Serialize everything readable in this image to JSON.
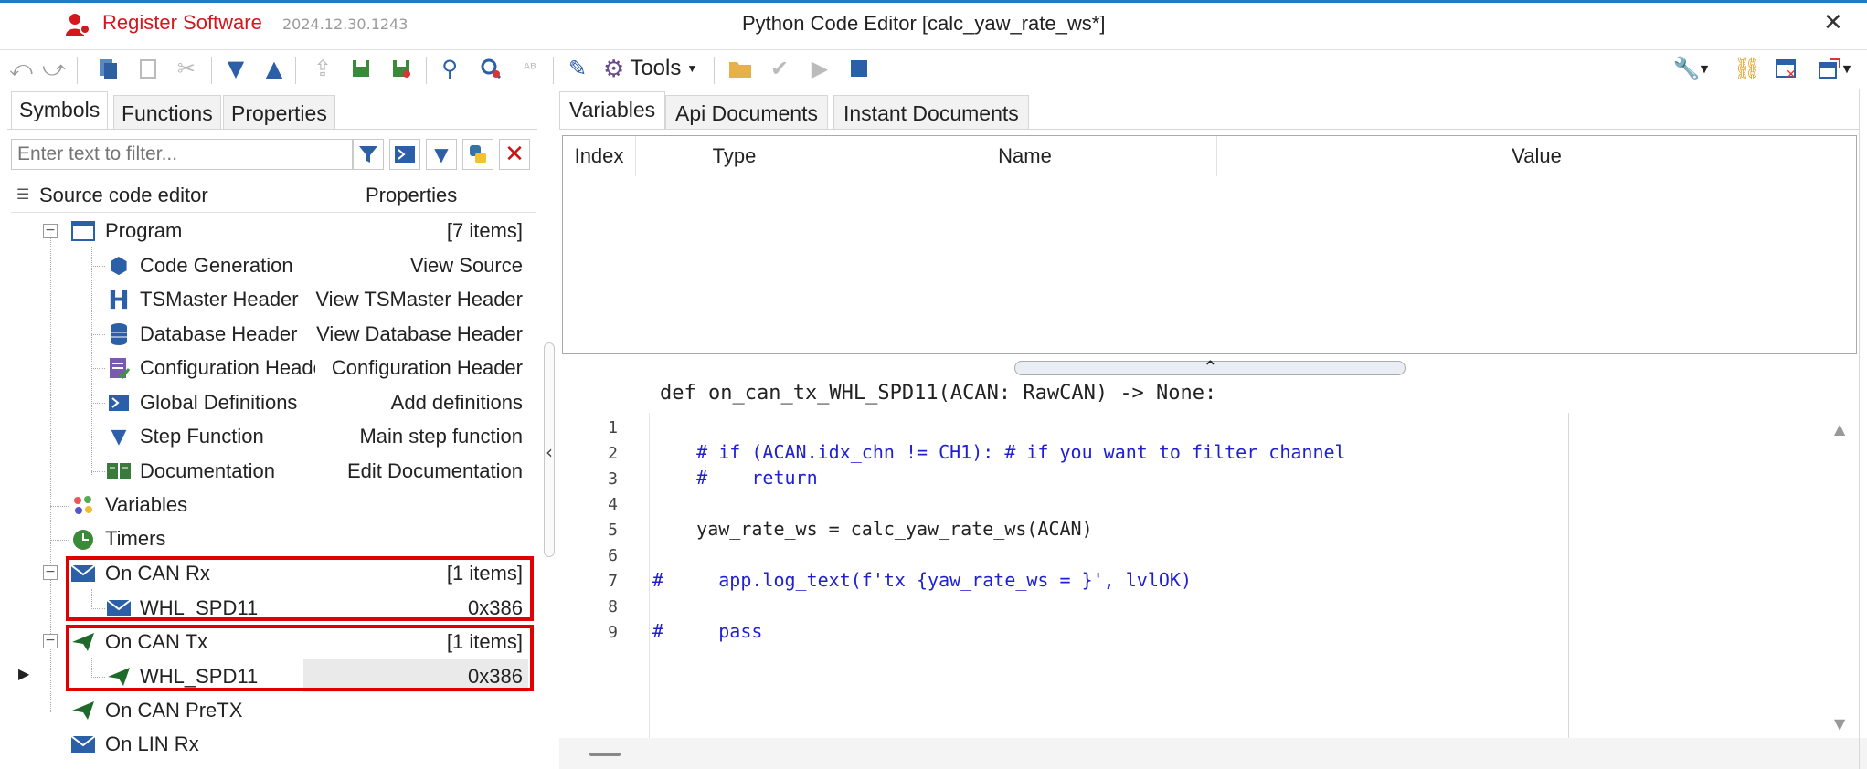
{
  "titlebar": {
    "register_label": "Register Software",
    "version": "2024.12.30.1243",
    "window_title": "Python Code Editor [calc_yaw_rate_ws*]",
    "close_glyph": "✕"
  },
  "toolbar": {
    "tools_label": "Tools",
    "icons": [
      "undo-icon",
      "redo-icon",
      "copy-icon",
      "paste-icon",
      "cut-icon",
      "move-down-icon",
      "move-up-icon",
      "export-icon",
      "save-icon",
      "save-as-icon",
      "search-icon",
      "find-replace-icon",
      "text-replace-icon",
      "pencil-icon",
      "gear-icon",
      "open-folder-icon",
      "check-icon",
      "run-icon",
      "stop-icon",
      "wrench-icon",
      "link-icon",
      "close-window-icon",
      "window-export-icon"
    ]
  },
  "left_tabs": [
    "Symbols",
    "Functions",
    "Properties"
  ],
  "filter": {
    "placeholder": "Enter text to filter..."
  },
  "tree_header": {
    "col1": "Source code editor",
    "col2": "Properties"
  },
  "tree": {
    "program": {
      "label": "Program",
      "value": "[7 items]"
    },
    "code_generation": {
      "label": "Code Generation",
      "value": "View Source"
    },
    "tsmaster_header": {
      "label": "TSMaster Header",
      "value": "View TSMaster Header"
    },
    "database_header": {
      "label": "Database Header",
      "value": "View Database Header"
    },
    "configuration_header": {
      "label": "Configuration Header",
      "value": "Configuration Header"
    },
    "global_definitions": {
      "label": "Global Definitions",
      "value": "Add definitions"
    },
    "step_function": {
      "label": "Step Function",
      "value": "Main step function"
    },
    "documentation": {
      "label": "Documentation",
      "value": "Edit Documentation"
    },
    "variables": {
      "label": "Variables"
    },
    "timers": {
      "label": "Timers"
    },
    "on_can_rx": {
      "label": "On CAN Rx",
      "value": "[1 items]"
    },
    "on_can_rx_item": {
      "label": "WHL_SPD11",
      "value": "0x386"
    },
    "on_can_tx": {
      "label": "On CAN Tx",
      "value": "[1 items]"
    },
    "on_can_tx_item": {
      "label": "WHL_SPD11",
      "value": "0x386"
    },
    "on_can_pretx": {
      "label": "On CAN PreTX"
    },
    "on_lin_rx": {
      "label": "On LIN Rx"
    }
  },
  "right_tabs": [
    "Variables",
    "Api Documents",
    "Instant Documents"
  ],
  "variables_table": {
    "columns": [
      "Index",
      "Type",
      "Name",
      "Value"
    ],
    "rows": []
  },
  "editor": {
    "signature": "def on_can_tx_WHL_SPD11(ACAN: RawCAN) -> None:",
    "line_numbers": [
      "1",
      "2",
      "3",
      "4",
      "5",
      "6",
      "7",
      "8",
      "9"
    ],
    "lines": [
      "",
      "    # if (ACAN.idx_chn != CH1): # if you want to filter channel",
      "    #    return",
      "",
      "    yaw_rate_ws = calc_yaw_rate_ws(ACAN)",
      "",
      "#     app.log_text(f'tx {yaw_rate_ws = }', lvlOK)",
      "",
      "#     pass"
    ]
  },
  "colors": {
    "accent": "#1f7ac7",
    "register_red": "#d4161d",
    "highlight_box": "#e00000",
    "comment_blue": "#1f1fd6"
  }
}
